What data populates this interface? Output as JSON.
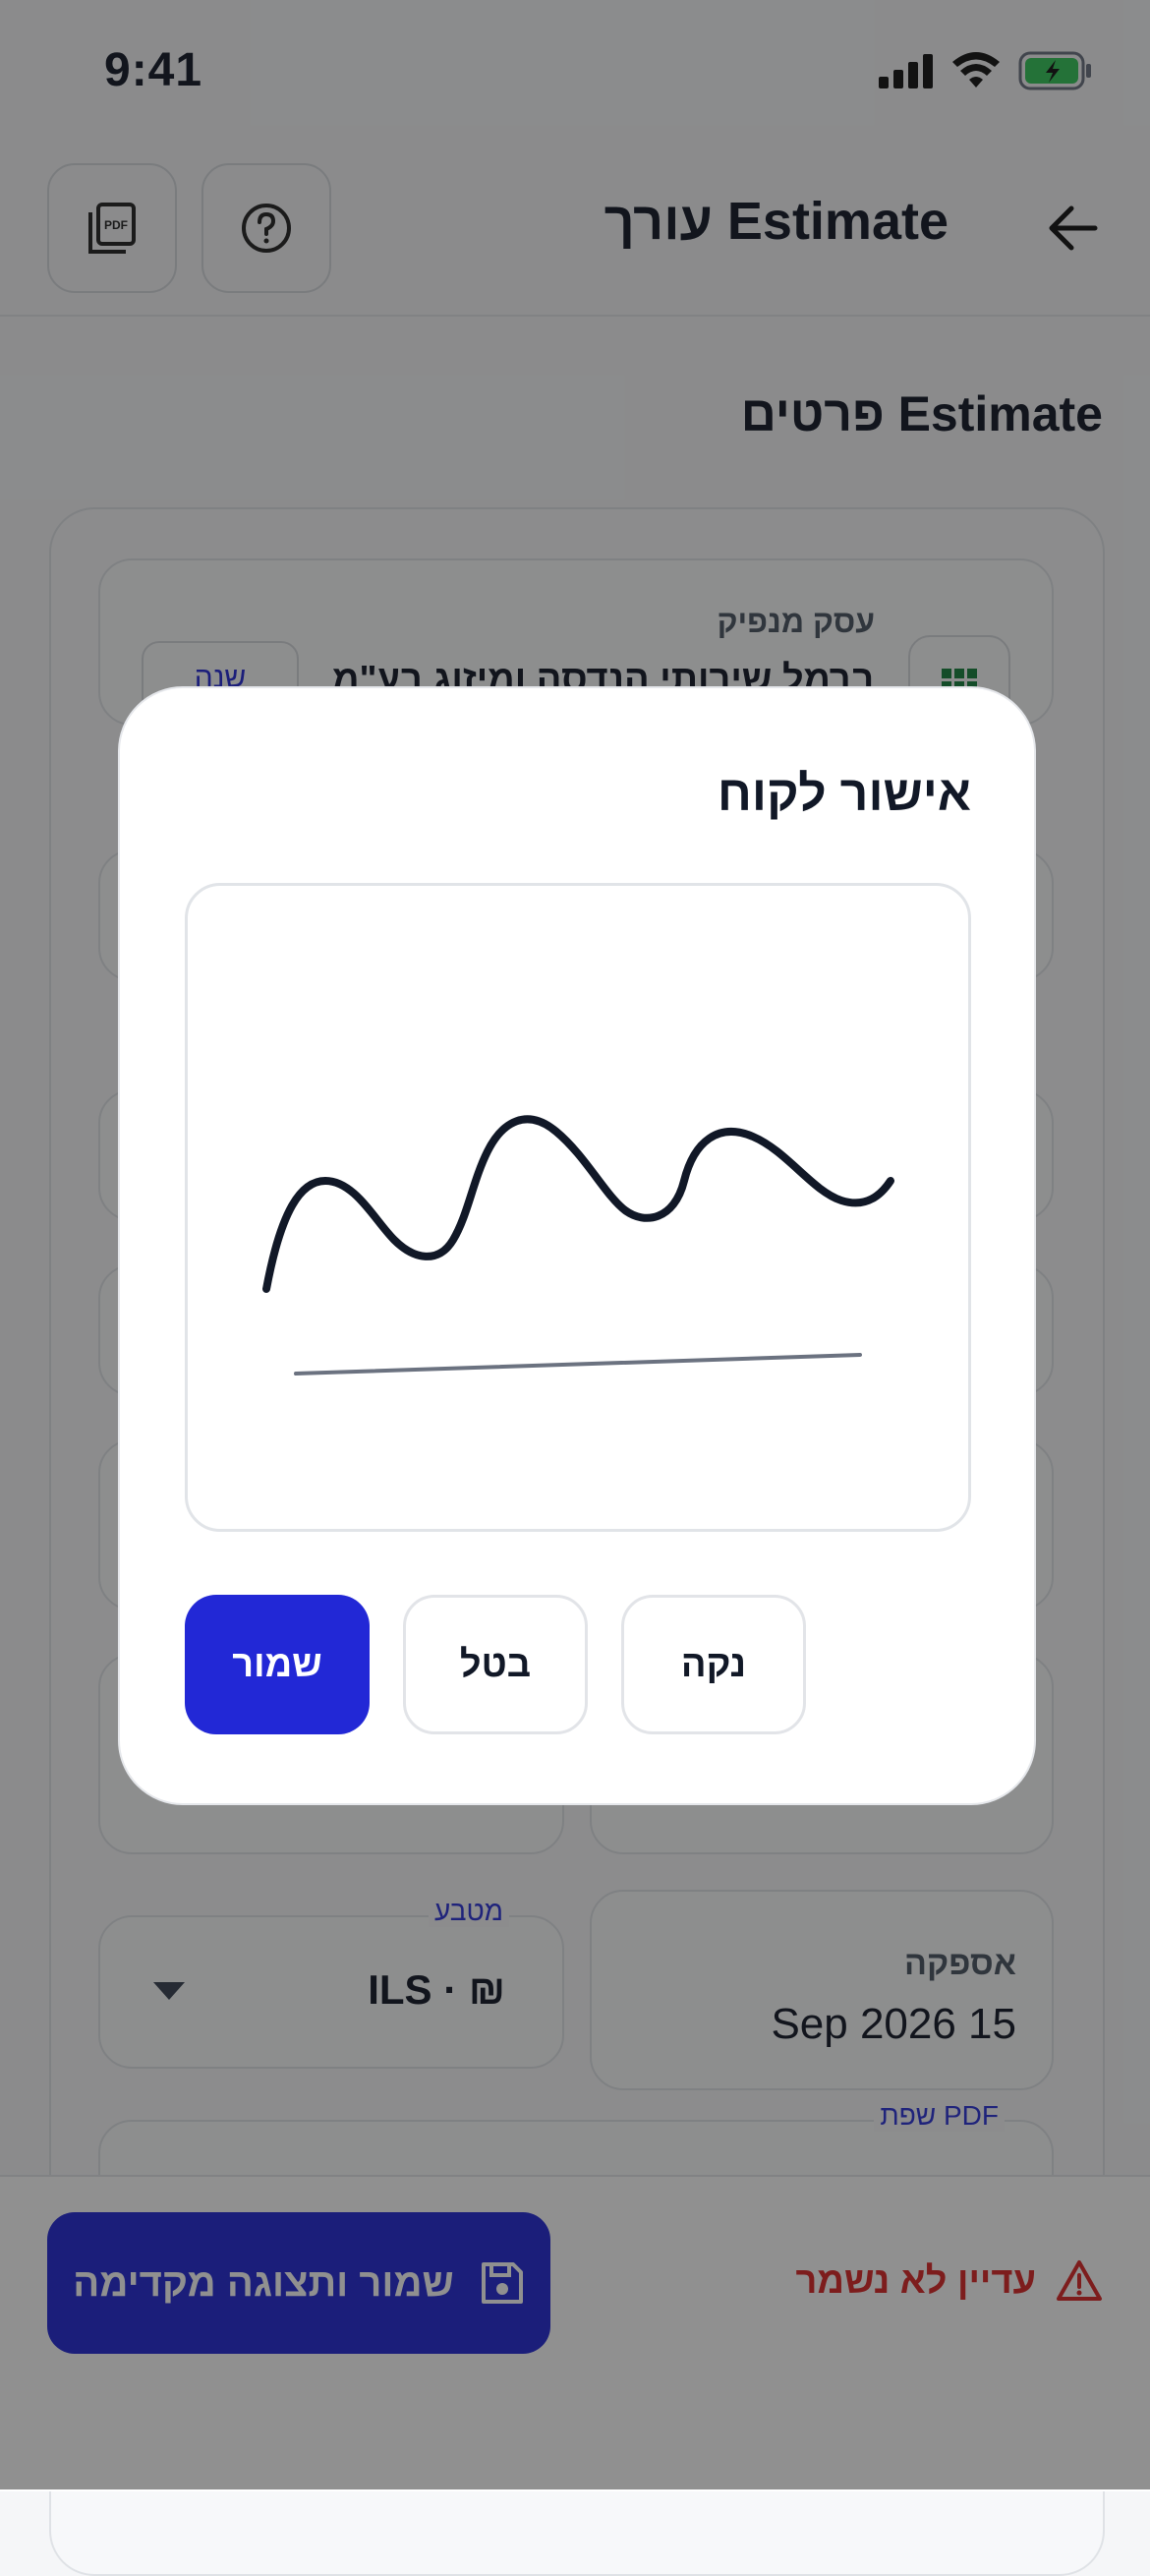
{
  "status": {
    "time": "9:41"
  },
  "header": {
    "title": "Estimate עורך"
  },
  "page": {
    "section_title": "Estimate פרטים"
  },
  "form": {
    "issuer_label": "עסק מנפיק",
    "issuer_value": "ברמל שירותי הנדסה ומיזוג בע\"מ",
    "issuer_change": "שנה",
    "delivery_label": "אספקה",
    "delivery_value": "Sep 2026 15",
    "currency_label": "מטבע",
    "currency_value": "₪ · ILS",
    "pdf_language_label": "PDF שפת"
  },
  "bottom": {
    "save_preview_label": "שמור ותצוגה מקדימה",
    "unsaved_label": "עדיין לא נשמר"
  },
  "modal": {
    "title": "אישור לקוח",
    "save_label": "שמור",
    "cancel_label": "בטל",
    "clear_label": "נקה"
  },
  "colors": {
    "primary": "#2228d6",
    "danger": "#dc2626",
    "text": "#111827",
    "overlay": "rgba(20,20,20,0.47)"
  },
  "icons": {
    "pdf": "pdf-icon",
    "help": "help-icon",
    "back": "arrow-right-icon",
    "save": "floppy-disk-icon",
    "warning": "warning-icon",
    "grid": "grid-icon",
    "dropdown": "caret-down-icon"
  }
}
